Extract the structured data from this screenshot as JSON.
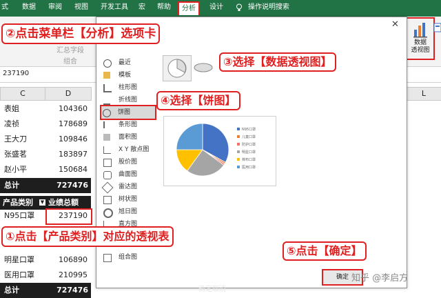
{
  "ribbon_tabs": [
    "式",
    "数据",
    "审阅",
    "视图",
    "开发工具",
    "宏",
    "帮助",
    "分析",
    "设计"
  ],
  "active_tab": "分析",
  "tell_me": "操作说明搜索",
  "ribbon": {
    "faint_label_1": "汇总字段",
    "faint_label_2": "组合",
    "pivot_chart_label": "数据\n透视图"
  },
  "formula_bar_value": "237190",
  "sheet": {
    "col_c": "C",
    "col_d": "D",
    "col_l": "L",
    "rows": [
      {
        "name": "表姐",
        "value": "104360"
      },
      {
        "name": "凌祯",
        "value": "178689"
      },
      {
        "name": "王大刀",
        "value": "109846"
      },
      {
        "name": "张盛茗",
        "value": "183897"
      },
      {
        "name": "赵小平",
        "value": "150684"
      }
    ],
    "total1": {
      "label": "总计",
      "value": "727476"
    },
    "pivot_header": {
      "col1": "产品类别",
      "col2": "业绩总额"
    },
    "pivot_row": {
      "name": "N95口罩",
      "value": "237190"
    },
    "pivot_rows_lower": [
      {
        "name": "明星口罩",
        "value": "106890"
      },
      {
        "name": "医用口罩",
        "value": "210995"
      }
    ],
    "total2": {
      "label": "总计",
      "value": "727476"
    }
  },
  "dialog": {
    "chart_types": [
      "最近",
      "模板",
      "柱形图",
      "折线图",
      "饼图",
      "条形图",
      "面积图",
      "X Y 散点图",
      "股价图",
      "曲面图",
      "雷达图",
      "树状图",
      "旭日图",
      "直方图",
      "组合图"
    ],
    "selected_type": "饼图",
    "ok_label": "确定",
    "faint_bottom": "确定取消"
  },
  "pie_preview": {
    "slices": [
      0.33,
      0.01,
      0.01,
      0.25,
      0.15,
      0.25
    ],
    "colors": [
      "#4472c4",
      "#ed7d31",
      "#ff6f61",
      "#a5a5a5",
      "#ffc000",
      "#5b9bd5"
    ],
    "legend": [
      "N95口罩",
      "儿童口罩",
      "防护口罩",
      "明星口罩",
      "棉布口罩",
      "医用口罩"
    ]
  },
  "callouts": {
    "c1": "①点击【产品类别】对应的透视表",
    "c2": "②点击菜单栏【分析】选项卡",
    "c3": "③选择【数据透视图】",
    "c4": "④选择【饼图】",
    "c5": "⑤点击【确定】"
  },
  "watermark": "知乎 @李启方"
}
